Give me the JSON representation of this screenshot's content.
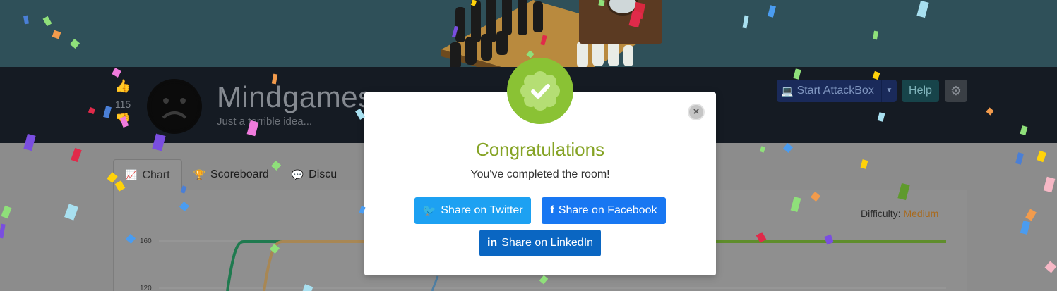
{
  "room": {
    "title": "Mindgames",
    "subtitle": "Just a terrible idea...",
    "votes": "115",
    "difficulty_label": "Difficulty:",
    "difficulty_value": "Medium"
  },
  "header_buttons": {
    "attackbox": "Start AttackBox",
    "help": "Help"
  },
  "tabs": [
    {
      "label": "Chart",
      "icon": "chart-line-icon"
    },
    {
      "label": "Scoreboard",
      "icon": "trophy-icon"
    },
    {
      "label": "Discu",
      "icon": "comments-icon"
    }
  ],
  "chart_data": {
    "type": "line",
    "y_ticks": [
      "160",
      "120"
    ],
    "series": [
      {
        "color": "#1f7a4f"
      },
      {
        "color": "#a88754"
      },
      {
        "color": "#5f8d2c"
      },
      {
        "color": "#4f7fa3"
      }
    ]
  },
  "modal": {
    "title": "Congratulations",
    "message": "You've completed the room!",
    "twitter": "Share on Twitter",
    "facebook": "Share on Facebook",
    "linkedin": "Share on LinkedIn",
    "close": "×"
  },
  "colors": {
    "accent_green": "#85a324",
    "badge_green": "#8ac234",
    "twitter": "#1da1f2",
    "facebook": "#1877f2",
    "linkedin": "#0a66c2"
  }
}
